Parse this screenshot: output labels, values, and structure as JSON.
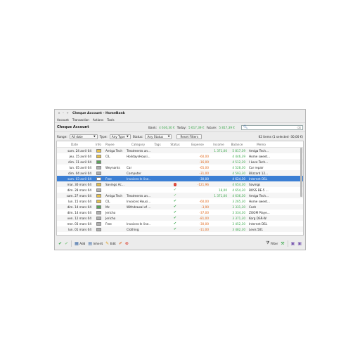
{
  "window": {
    "title": "Cheque Account - HomeBank",
    "controls": [
      "×",
      "–",
      "+"
    ]
  },
  "menu": [
    "Account",
    "Transaction",
    "Actions",
    "Tools"
  ],
  "account": {
    "name": "Cheque Account",
    "bank_label": "Bank:",
    "bank_value": "4 636,30 €",
    "today_label": "Today:",
    "today_value": "5 617,39 €",
    "future_label": "Future:",
    "future_value": "5 817,39 €"
  },
  "search": {
    "placeholder": ""
  },
  "filters": {
    "range_label": "Range:",
    "range_value": "All date",
    "type_label": "Type:",
    "type_value": "Any Type",
    "status_label": "Status:",
    "status_value": "Any Status",
    "reset_label": "Reset Filters",
    "count": "62 items (1 selected -30,00 €)"
  },
  "columns": [
    "Date",
    "Info",
    "Payee",
    "Category",
    "Tags",
    "Status",
    "Expense",
    "Income",
    "Balance",
    "Memo"
  ],
  "rows": [
    {
      "date": "sam. 24 avril 04",
      "info": "#e5c04a",
      "payee": "Amiga Tech",
      "category": "Treatments an...",
      "tags": "",
      "status": "",
      "expense": "",
      "income": "1 371,00",
      "balance": "5 817,39",
      "memo": "Amiga Tech..."
    },
    {
      "date": "jeu. 15 avril 04",
      "info": "#e5c04a",
      "payee": "CIL",
      "category": "HolidaysHousi...",
      "tags": "",
      "status": "",
      "expense": "-60,00",
      "income": "",
      "balance": "4 446,39",
      "memo": "Home sweet..."
    },
    {
      "date": "dim. 11 avril 04",
      "info": "#5aa35a",
      "payee": "",
      "category": "",
      "tags": "",
      "status": "",
      "expense": "-16,00",
      "income": "",
      "balance": "4 512,39",
      "memo": "I Love Tech..."
    },
    {
      "date": "lun. 05 avril 04",
      "info": "#b0b0b0",
      "payee": "Weynants",
      "category": "Car",
      "tags": "",
      "status": "",
      "expense": "-65,00",
      "income": "",
      "balance": "4 528,30",
      "memo": "Car repair"
    },
    {
      "date": "dim. 04 avril 04",
      "info": "#b0b0b0",
      "payee": "",
      "category": "Computer",
      "tags": "",
      "status": "",
      "expense": "-31,00",
      "income": "",
      "balance": "4 593,30",
      "memo": "Blizzard 12..."
    },
    {
      "date": "sam. 03 avril 04",
      "info": "#ffffff",
      "payee": "Free",
      "category": "Invoices:In line...",
      "tags": "",
      "status": "",
      "expense": "-30,00",
      "income": "",
      "balance": "4 624,30",
      "memo": "Internet DSL"
    },
    {
      "date": "mar. 30 mars 04",
      "info": "#e5c04a",
      "payee": "Savings Ac...",
      "category": "",
      "tags": "",
      "status": "rem",
      "expense": "-121,96",
      "income": "",
      "balance": "4 654,30",
      "memo": "Savings"
    },
    {
      "date": "dim. 28 mars 04",
      "info": "#b0b0b0",
      "payee": "",
      "category": "",
      "tags": "",
      "status": "lt",
      "expense": "",
      "income": "18,00",
      "balance": "4 654,30",
      "memo": "BOSS BE-5 ..."
    },
    {
      "date": "sam. 27 mars 04",
      "info": "#e5c04a",
      "payee": "Amiga Tech",
      "category": "Treatments an...",
      "tags": "",
      "status": "lt",
      "expense": "",
      "income": "1 371,00",
      "balance": "4 636,30",
      "memo": "Amiga Tech..."
    },
    {
      "date": "lun. 15 mars 04",
      "info": "#e5c04a",
      "payee": "CIL",
      "category": "Invoices:Housi...",
      "tags": "",
      "status": "ok",
      "expense": "-60,00",
      "income": "",
      "balance": "3 265,30",
      "memo": "Home sweet..."
    },
    {
      "date": "dim. 14 mars 04",
      "info": "#5aa35a",
      "payee": "Mc",
      "category": "Withdrawal of ...",
      "tags": "",
      "status": "ok",
      "expense": "-3,90",
      "income": "",
      "balance": "3 331,30",
      "memo": "Cash"
    },
    {
      "date": "dim. 14 mars 04",
      "info": "#b0b0b0",
      "payee": "Jericho",
      "category": "",
      "tags": "",
      "status": "ok",
      "expense": "-37,00",
      "income": "",
      "balance": "3 334,30",
      "memo": "ZOOM Playe..."
    },
    {
      "date": "ven. 12 mars 04",
      "info": "#b0b0b0",
      "payee": "Jericho",
      "category": "",
      "tags": "",
      "status": "ok",
      "expense": "-81,00",
      "income": "",
      "balance": "3 371,30",
      "memo": "Korg DSR-W"
    },
    {
      "date": "mer. 03 mars 04",
      "info": "#b0b0b0",
      "payee": "Free",
      "category": "Invoices:In line...",
      "tags": "",
      "status": "ok",
      "expense": "-30,00",
      "income": "",
      "balance": "3 452,30",
      "memo": "Internet DSL"
    },
    {
      "date": "lun. 01 mars 04",
      "info": "#b0b0b0",
      "payee": "",
      "category": "Clothing",
      "tags": "",
      "status": "ok",
      "expense": "-11,00",
      "income": "",
      "balance": "3 482,30",
      "memo": "Levis 501"
    }
  ],
  "selected_row": 5,
  "toolbar": {
    "add": "Add",
    "inherit": "Inherit",
    "edit": "Edit",
    "filter": "Filter"
  }
}
